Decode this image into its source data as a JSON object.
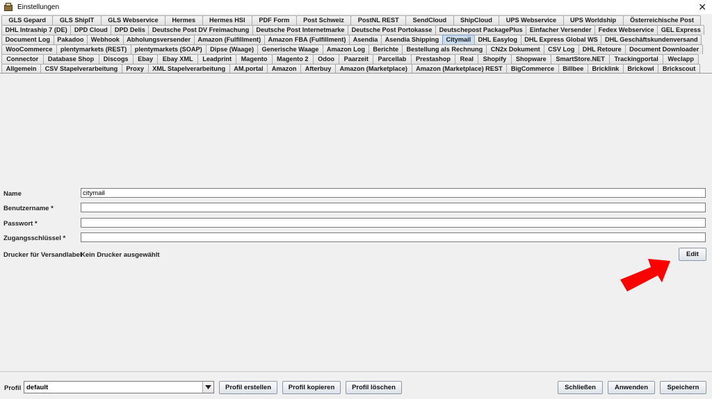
{
  "window": {
    "title": "Einstellungen",
    "app_icon": "settings-app-icon",
    "close_icon": "close-icon"
  },
  "tabs": {
    "rows": [
      [
        "GLS Gepard",
        "GLS ShipIT",
        "GLS Webservice",
        "Hermes",
        "Hermes HSI",
        "PDF Form",
        "Post Schweiz",
        "PostNL REST",
        "SendCloud",
        "ShipCloud",
        "UPS Webservice",
        "UPS Worldship",
        "Österreichische Post"
      ],
      [
        "DHL Intraship 7 (DE)",
        "DPD Cloud",
        "DPD Delis",
        "Deutsche Post DV Freimachung",
        "Deutsche Post Internetmarke",
        "Deutsche Post Portokasse",
        "Deutschepost PackagePlus",
        "Einfacher Versender",
        "Fedex Webservice",
        "GEL Express"
      ],
      [
        "Document Log",
        "Pakadoo",
        "Webhook",
        "Abholungsversender",
        "Amazon (Fulfillment)",
        "Amazon FBA (Fulfillment)",
        "Asendia",
        "Asendia Shipping",
        "Citymail",
        "DHL Easylog",
        "DHL Express Global WS",
        "DHL Geschäftskundenversand"
      ],
      [
        "WooCommerce",
        "plentymarkets (REST)",
        "plentymarkets (SOAP)",
        "Dipse (Waage)",
        "Generische Waage",
        "Amazon Log",
        "Berichte",
        "Bestellung als Rechnung",
        "CN2x Dokument",
        "CSV Log",
        "DHL Retoure",
        "Document Downloader"
      ],
      [
        "Connector",
        "Database Shop",
        "Discogs",
        "Ebay",
        "Ebay XML",
        "Leadprint",
        "Magento",
        "Magento 2",
        "Odoo",
        "Paarzeit",
        "Parcellab",
        "Prestashop",
        "Real",
        "Shopify",
        "Shopware",
        "SmartStore.NET",
        "Trackingportal",
        "Weclapp"
      ],
      [
        "Allgemein",
        "CSV Stapelverarbeitung",
        "Proxy",
        "XML Stapelverarbeitung",
        "AM.portal",
        "Amazon",
        "Afterbuy",
        "Amazon (Marketplace)",
        "Amazon (Marketplace) REST",
        "BigCommerce",
        "Billbee",
        "Bricklink",
        "Brickowl",
        "Brickscout"
      ]
    ],
    "active": "Citymail"
  },
  "form": {
    "name_label": "Name",
    "name_value": "citymail",
    "username_label": "Benutzername *",
    "username_value": "",
    "password_label": "Passwort *",
    "password_value": "",
    "access_key_label": "Zugangsschlüssel *",
    "access_key_value": "",
    "printer_label": "Drucker für Versandlabel",
    "printer_value": "Kein Drucker ausgewählt",
    "edit_label": "Edit"
  },
  "annotation": {
    "icon": "red-arrow-icon",
    "color": "#ff0000"
  },
  "bottom": {
    "profile_label": "Profil",
    "profile_value": "default",
    "dropdown_icon": "dropdown-arrow-icon",
    "create_label": "Profil erstellen",
    "copy_label": "Profil kopieren",
    "delete_label": "Profil löschen",
    "close_label": "Schließen",
    "apply_label": "Anwenden",
    "save_label": "Speichern"
  }
}
